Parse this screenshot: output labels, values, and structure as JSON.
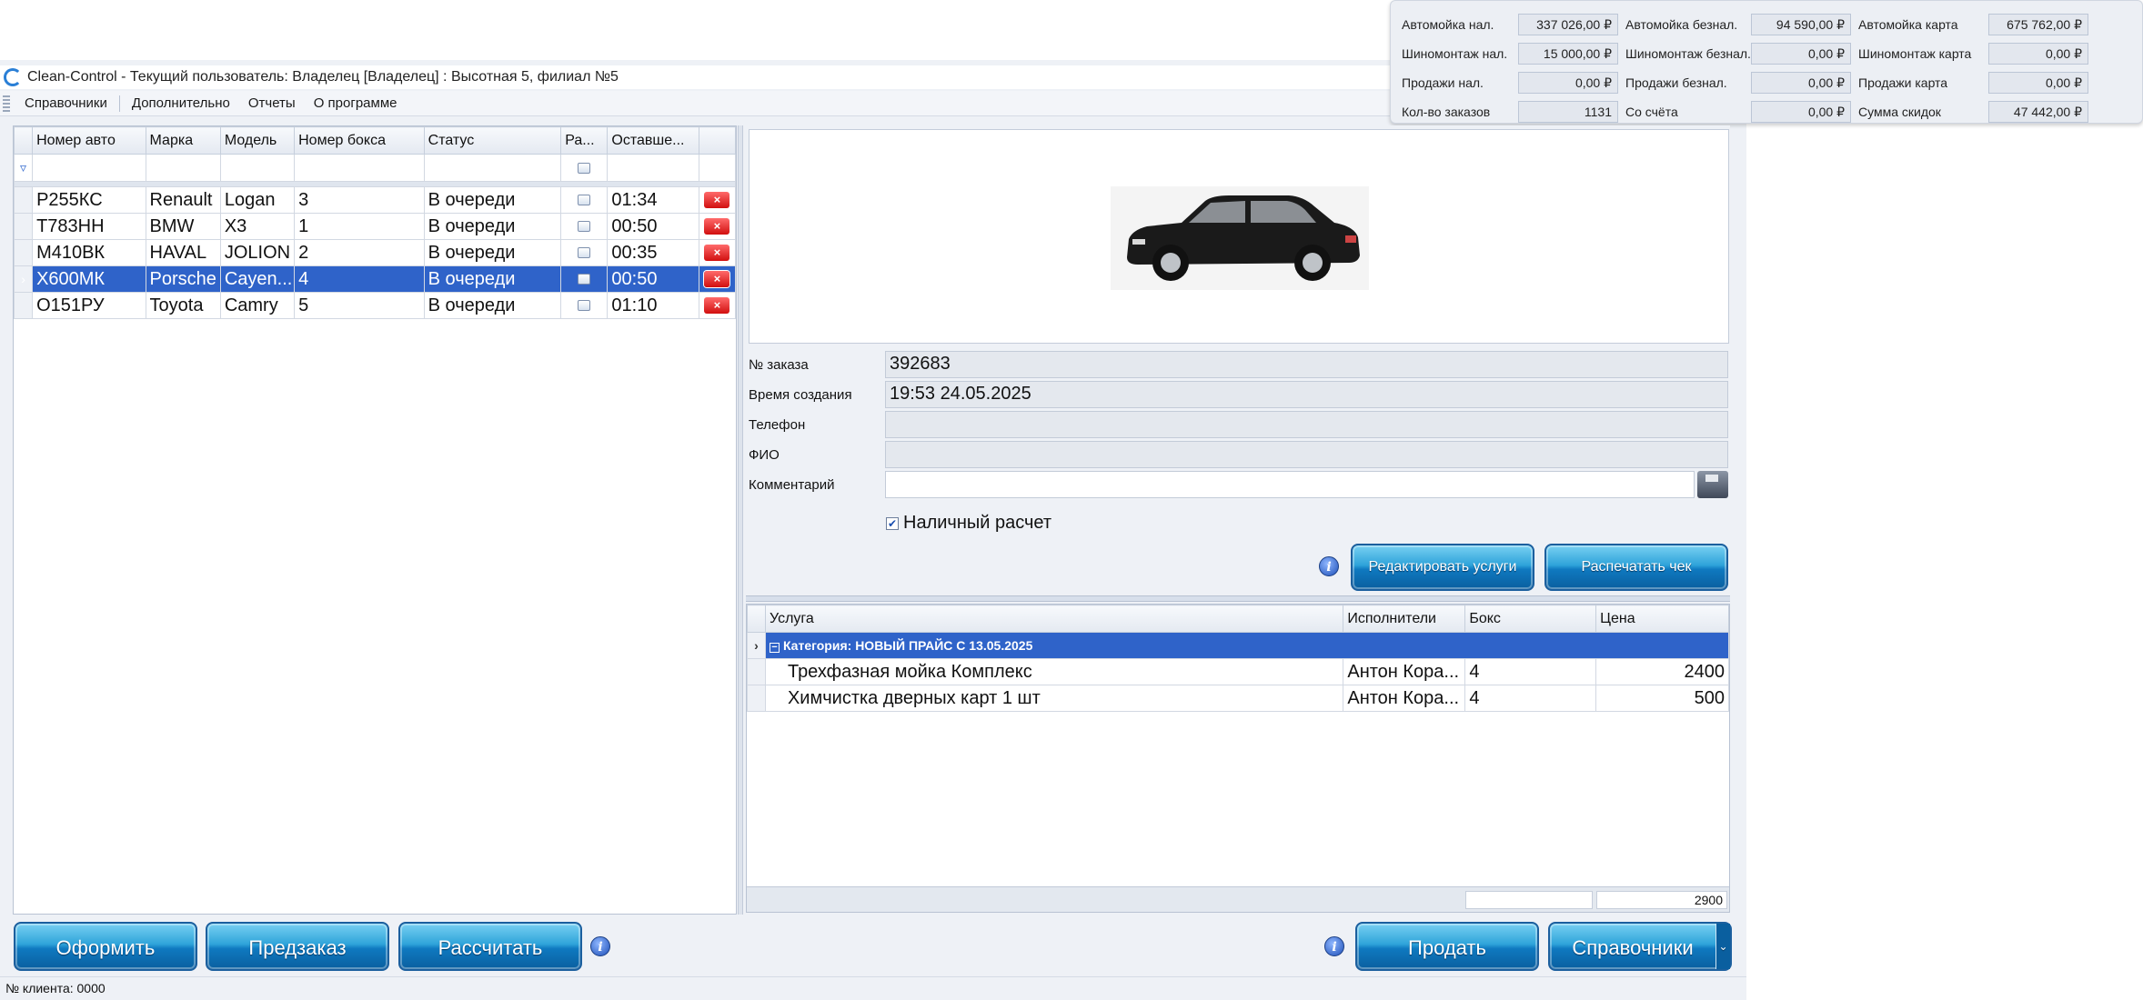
{
  "window": {
    "title": "Clean-Control - Текущий пользователь: Владелец [Владелец] : Высотная 5, филиал №5"
  },
  "menu": [
    "Справочники",
    "Дополнительно",
    "Отчеты",
    "О программе"
  ],
  "summary": [
    {
      "label": "Автомойка нал.",
      "value": "337 026,00 ₽"
    },
    {
      "label": "Автомойка безнал.",
      "value": "94 590,00 ₽"
    },
    {
      "label": "Автомойка карта",
      "value": "675 762,00 ₽"
    },
    {
      "label": "Шиномонтаж нал.",
      "value": "15 000,00 ₽"
    },
    {
      "label": "Шиномонтаж безнал.",
      "value": "0,00 ₽"
    },
    {
      "label": "Шиномонтаж карта",
      "value": "0,00 ₽"
    },
    {
      "label": "Продажи нал.",
      "value": "0,00 ₽"
    },
    {
      "label": "Продажи безнал.",
      "value": "0,00 ₽"
    },
    {
      "label": "Продажи карта",
      "value": "0,00 ₽"
    },
    {
      "label": "Кол-во заказов",
      "value": "1131"
    },
    {
      "label": "Со счёта",
      "value": "0,00 ₽"
    },
    {
      "label": "Сумма скидок",
      "value": "47 442,00 ₽"
    }
  ],
  "orders_grid": {
    "columns": [
      "Номер авто",
      "Марка",
      "Модель",
      "Номер бокса",
      "Статус",
      "Ра...",
      "Оставше..."
    ],
    "rows": [
      {
        "plate": "Р255КС",
        "brand": "Renault",
        "model": "Logan",
        "box": "3",
        "status": "В очереди",
        "remain": "01:34"
      },
      {
        "plate": "Т783НН",
        "brand": "BMW",
        "model": "X3",
        "box": "1",
        "status": "В очереди",
        "remain": "00:50"
      },
      {
        "plate": "М410ВК",
        "brand": "HAVAL",
        "model": "JOLION",
        "box": "2",
        "status": "В очереди",
        "remain": "00:35"
      },
      {
        "plate": "Х600МК",
        "brand": "Porsche",
        "model": "Cayen...",
        "box": "4",
        "status": "В очереди",
        "remain": "00:50"
      },
      {
        "plate": "О151РУ",
        "brand": "Toyota",
        "model": "Camry",
        "box": "5",
        "status": "В очереди",
        "remain": "01:10"
      }
    ],
    "selected_index": 3
  },
  "order": {
    "number_label": "№ заказа",
    "number": "392683",
    "created_label": "Время создания",
    "created": "19:53 24.05.2025",
    "phone_label": "Телефон",
    "phone": "",
    "name_label": "ФИО",
    "name": "",
    "comment_label": "Комментарий",
    "comment": "",
    "cash_label": "Наличный расчет",
    "cash_checked": true
  },
  "buttons": {
    "edit_services": "Редактировать услуги",
    "print_check": "Распечатать чек",
    "checkout": "Оформить",
    "preorder": "Предзаказ",
    "calculate": "Рассчитать",
    "sell": "Продать",
    "directories": "Справочники"
  },
  "services_grid": {
    "columns": [
      "Услуга",
      "Исполнители",
      "Бокс",
      "Цена"
    ],
    "category": "Категория: НОВЫЙ ПРАЙС С 13.05.2025",
    "rows": [
      {
        "service": "Трехфазная мойка Комплекс",
        "performer": "Антон Кора...",
        "box": "4",
        "price": "2400"
      },
      {
        "service": "Химчистка дверных карт 1 шт",
        "performer": "Антон Кора...",
        "box": "4",
        "price": "500"
      }
    ],
    "total": "2900"
  },
  "status_bar": {
    "client_number": "№ клиента: 0000"
  },
  "icons": {
    "app": "clean-control-icon",
    "info": "info-icon",
    "save": "save-icon",
    "delete": "delete-icon"
  },
  "colors": {
    "selection": "#2f63c9",
    "button": "#1e8fd0",
    "delete": "#e02020"
  }
}
